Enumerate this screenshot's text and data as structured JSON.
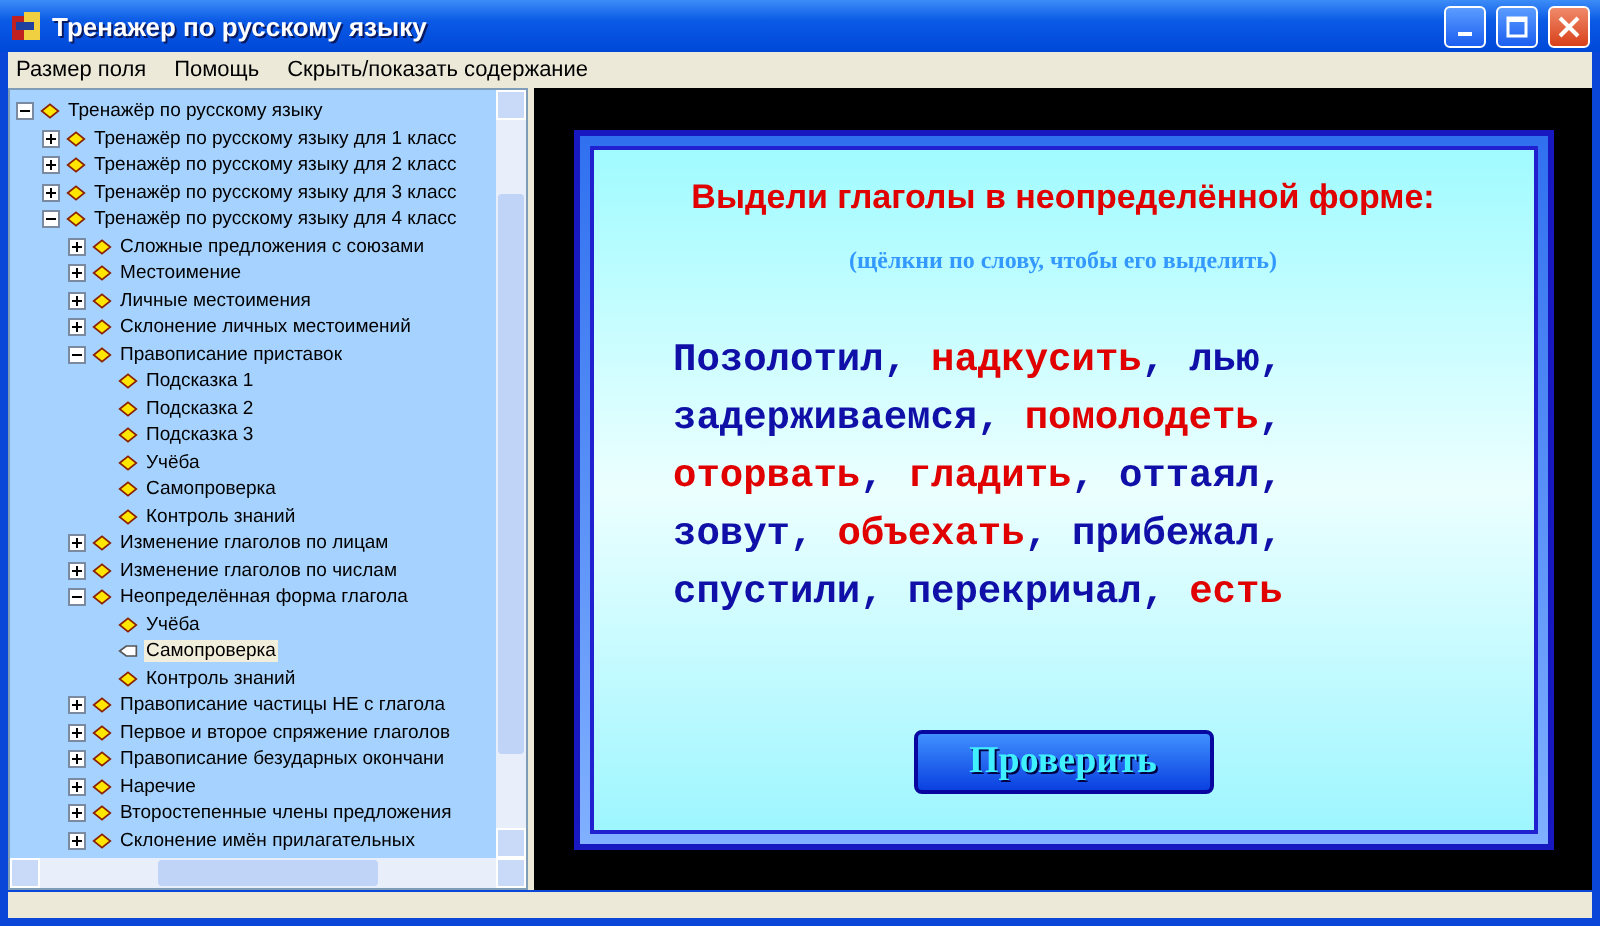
{
  "window": {
    "title": "Тренажер по русскому языку"
  },
  "menu": [
    "Размер поля",
    "Помощь",
    "Скрыть/показать содержание"
  ],
  "tree": [
    {
      "label": "Тренажёр по русскому языку",
      "expanded": true,
      "selected": false,
      "children": [
        {
          "label": "Тренажёр по русскому языку для 1 класс",
          "expanded": false,
          "selected": false
        },
        {
          "label": "Тренажёр по русскому языку для 2 класс",
          "expanded": false,
          "selected": false
        },
        {
          "label": "Тренажёр по русскому языку для 3 класс",
          "expanded": false,
          "selected": false
        },
        {
          "label": "Тренажёр по русскому языку для 4 класс",
          "expanded": true,
          "selected": false,
          "children": [
            {
              "label": "Сложные предложения с союзами",
              "expanded": false,
              "selected": false
            },
            {
              "label": "Местоимение",
              "expanded": false,
              "selected": false
            },
            {
              "label": "Личные местоимения",
              "expanded": false,
              "selected": false
            },
            {
              "label": "Склонение личных местоимений",
              "expanded": false,
              "selected": false
            },
            {
              "label": "Правописание приставок",
              "expanded": true,
              "selected": false,
              "children": [
                {
                  "label": "Подсказка 1",
                  "selected": false
                },
                {
                  "label": "Подсказка 2",
                  "selected": false
                },
                {
                  "label": "Подсказка 3",
                  "selected": false
                },
                {
                  "label": "Учёба",
                  "selected": false
                },
                {
                  "label": "Самопроверка",
                  "selected": false
                },
                {
                  "label": "Контроль знаний",
                  "selected": false
                }
              ]
            },
            {
              "label": "Изменение глаголов по лицам",
              "expanded": false,
              "selected": false
            },
            {
              "label": "Изменение глаголов по числам",
              "expanded": false,
              "selected": false
            },
            {
              "label": "Неопределённая форма глагола",
              "expanded": true,
              "selected": false,
              "children": [
                {
                  "label": "Учёба",
                  "selected": false
                },
                {
                  "label": "Самопроверка",
                  "selected": true
                },
                {
                  "label": "Контроль знаний",
                  "selected": false
                }
              ]
            },
            {
              "label": "Правописание частицы НЕ с глагола",
              "expanded": false,
              "selected": false
            },
            {
              "label": "Первое и второе спряжение глаголов",
              "expanded": false,
              "selected": false
            },
            {
              "label": "Правописание безударных окончани",
              "expanded": false,
              "selected": false
            },
            {
              "label": "Наречие",
              "expanded": false,
              "selected": false
            },
            {
              "label": "Второстепенные члены предложения",
              "expanded": false,
              "selected": false
            },
            {
              "label": "Склонение имён прилагательных",
              "expanded": false,
              "selected": false
            }
          ]
        }
      ]
    }
  ],
  "exercise": {
    "title": "Выдели глаголы в неопределённой форме:",
    "hint": "(щёлкни по слову, чтобы его выделить)",
    "lines": [
      [
        {
          "text": "Позолотил",
          "punct": ",",
          "selected": false
        },
        {
          "text": "надкусить",
          "punct": ",",
          "selected": true
        },
        {
          "text": "лью",
          "punct": ",",
          "selected": false
        }
      ],
      [
        {
          "text": "задерживаемся",
          "punct": ",",
          "selected": false
        },
        {
          "text": "помолодеть",
          "punct": ",",
          "selected": true
        }
      ],
      [
        {
          "text": "оторвать",
          "punct": ",",
          "selected": true
        },
        {
          "text": "гладить",
          "punct": ",",
          "selected": true
        },
        {
          "text": "оттаял",
          "punct": ",",
          "selected": false
        }
      ],
      [
        {
          "text": "зовут",
          "punct": ",",
          "selected": false
        },
        {
          "text": "объехать",
          "punct": ",",
          "selected": true
        },
        {
          "text": "прибежал",
          "punct": ",",
          "selected": false
        }
      ],
      [
        {
          "text": "спустили",
          "punct": ",",
          "selected": false
        },
        {
          "text": "перекричал",
          "punct": ",",
          "selected": false
        },
        {
          "text": "есть",
          "selected": true
        }
      ]
    ],
    "button": "Проверить"
  }
}
